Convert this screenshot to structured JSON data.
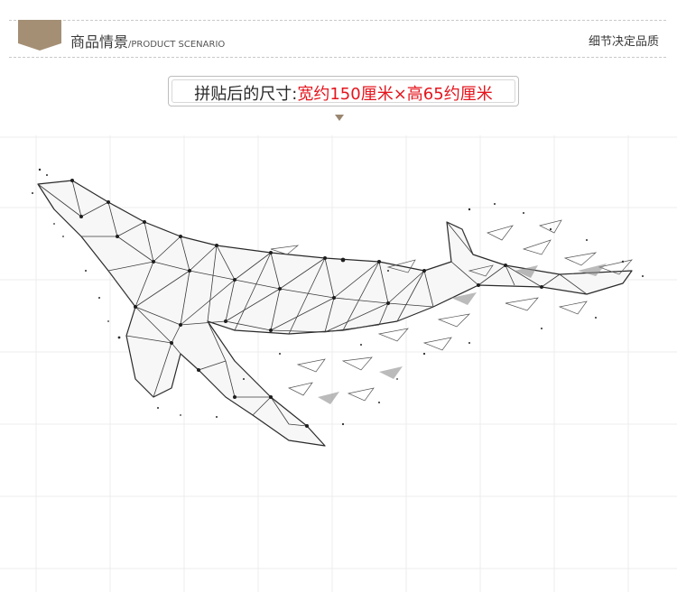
{
  "header": {
    "title": "商品情景",
    "title_en": "/PRODUCT SCENARIO",
    "tagline": "细节决定品质",
    "tab_color": "#a48f75"
  },
  "size_badge": {
    "label": "拼贴后的尺寸:",
    "value": "宽约150厘米×高65约厘米",
    "value_color": "#e4151d",
    "pointer_color": "#9a8670"
  },
  "scene": {
    "subject": "whale-icon"
  }
}
